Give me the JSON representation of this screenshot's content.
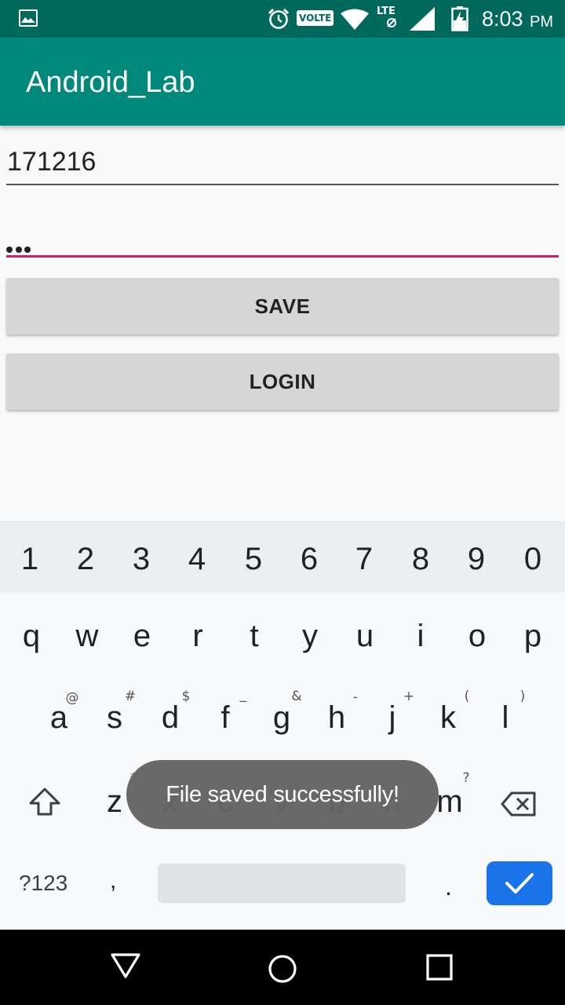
{
  "status_bar": {
    "volte": "VOLTE",
    "lte": "LTE",
    "time": "8:03",
    "ampm": "PM",
    "icons": [
      "gallery-icon",
      "alarm-icon",
      "wifi-icon",
      "lte-icon",
      "signal-icon",
      "battery-icon"
    ]
  },
  "app_bar": {
    "title": "Android_Lab",
    "color": "#00897b"
  },
  "form": {
    "username_value": "171216",
    "password_masked": "•••",
    "accent_color": "#d81b60"
  },
  "buttons": {
    "save": "SAVE",
    "login": "LOGIN"
  },
  "keyboard": {
    "numbers": [
      "1",
      "2",
      "3",
      "4",
      "5",
      "6",
      "7",
      "8",
      "9",
      "0"
    ],
    "row1": [
      "q",
      "w",
      "e",
      "r",
      "t",
      "y",
      "u",
      "i",
      "o",
      "p"
    ],
    "row2": [
      "a",
      "s",
      "d",
      "f",
      "g",
      "h",
      "j",
      "k",
      "l"
    ],
    "row2_hints": [
      "@",
      "#",
      "$",
      "_",
      "&",
      "-",
      "+",
      "(",
      ")"
    ],
    "row3": [
      "z",
      "x",
      "c",
      "v",
      "b",
      "n",
      "m"
    ],
    "row3_hints": [
      "*",
      "\"",
      "'",
      ":",
      ";",
      "!",
      "?"
    ],
    "symbols_key": "?123",
    "comma": ",",
    "period": ".",
    "enter_color": "#1a73e8"
  },
  "toast": {
    "message": "File saved successfully!"
  },
  "nav_bar": {
    "icons": [
      "back-icon",
      "home-icon",
      "recents-icon"
    ]
  }
}
